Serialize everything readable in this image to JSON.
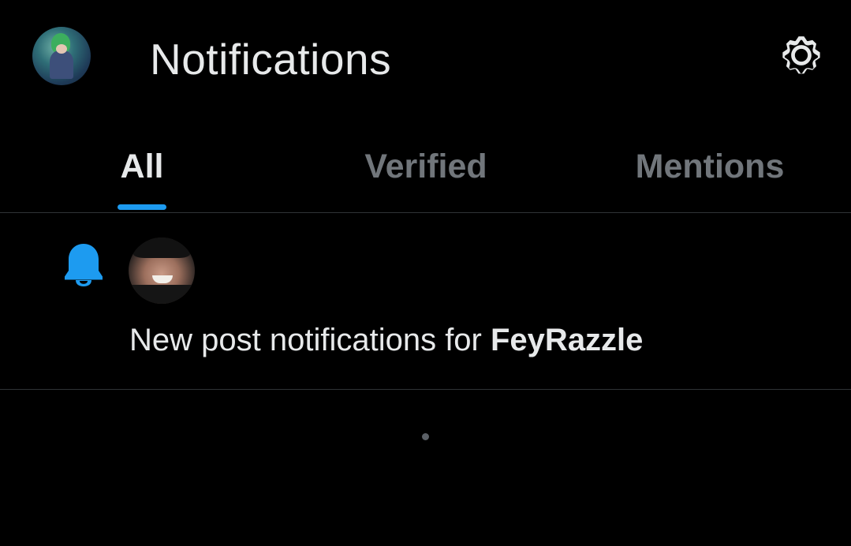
{
  "header": {
    "title": "Notifications",
    "avatar_icon": "user-avatar",
    "settings_icon": "gear-icon"
  },
  "tabs": [
    {
      "label": "All",
      "active": true
    },
    {
      "label": "Verified",
      "active": false
    },
    {
      "label": "Mentions",
      "active": false
    }
  ],
  "notifications": [
    {
      "icon": "bell-icon",
      "text": "New post notifications for ",
      "user": "FeyRazzle"
    }
  ],
  "colors": {
    "background": "#000000",
    "accent": "#1d9bf0",
    "text_primary": "#e7e9ea",
    "text_secondary": "#71767b",
    "divider": "#2f3336"
  }
}
